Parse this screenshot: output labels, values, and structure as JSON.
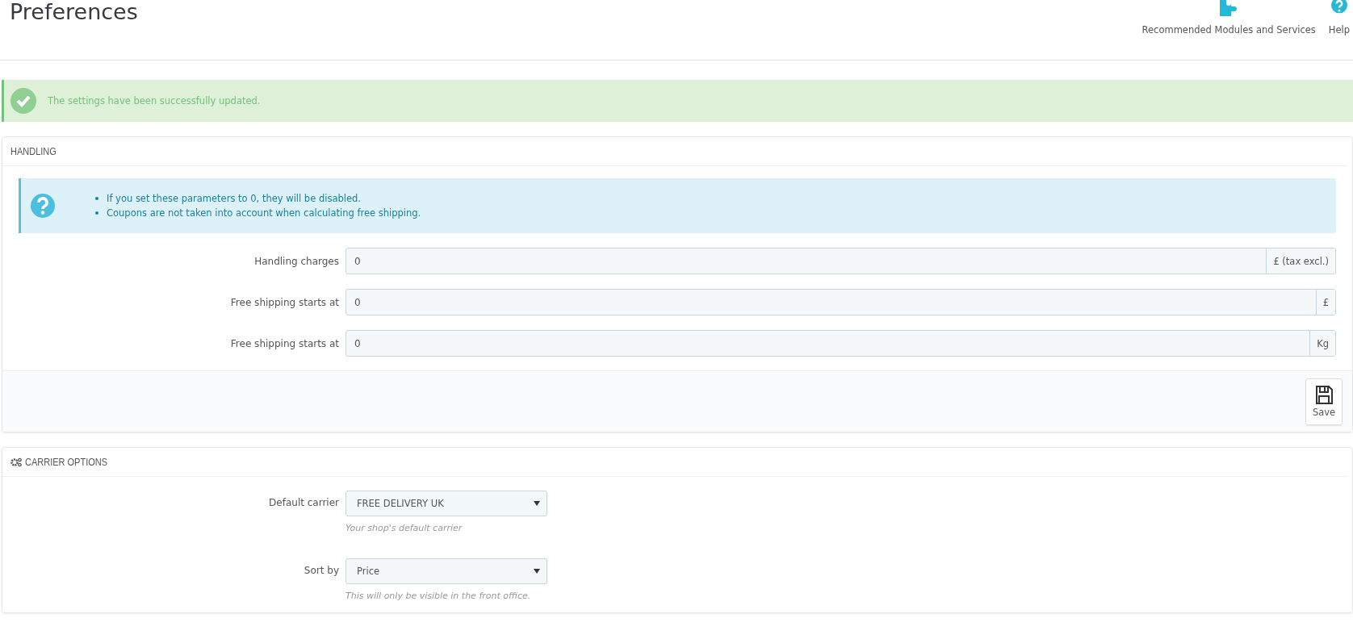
{
  "header": {
    "title": "Preferences",
    "toolbar": [
      {
        "kind": "modules",
        "label": "Recommended Modules and Services"
      },
      {
        "kind": "help",
        "label": "Help"
      }
    ]
  },
  "alert": {
    "message": "The settings have been successfully updated."
  },
  "handling": {
    "title": "HANDLING",
    "info": [
      "If you set these parameters to 0, they will be disabled.",
      "Coupons are not taken into account when calculating free shipping."
    ],
    "fields": [
      {
        "label": "Handling charges",
        "value": "0",
        "suffix": "£ (tax excl.)"
      },
      {
        "label": "Free shipping starts at",
        "value": "0",
        "suffix": "£"
      },
      {
        "label": "Free shipping starts at",
        "value": "0",
        "suffix": "Kg"
      }
    ],
    "save": "Save"
  },
  "carrier_options": {
    "title": "CARRIER OPTIONS",
    "fields": [
      {
        "label": "Default carrier",
        "value": "FREE DELIVERY UK",
        "hint": "Your shop's default carrier"
      },
      {
        "label": "Sort by",
        "value": "Price",
        "hint": "This will only be visible in the front office."
      }
    ]
  }
}
